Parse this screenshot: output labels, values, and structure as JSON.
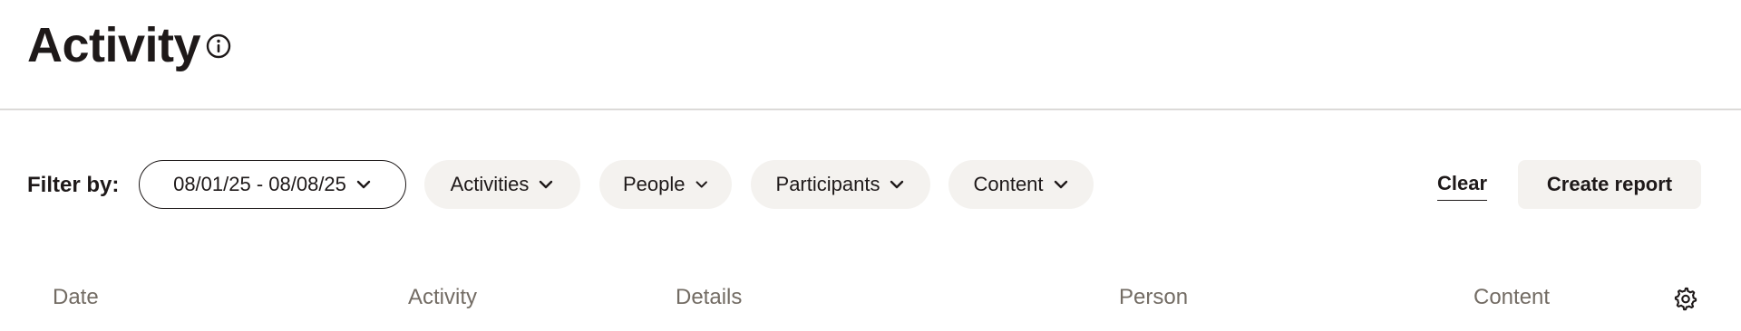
{
  "header": {
    "title": "Activity",
    "info_icon": "info-icon"
  },
  "filters": {
    "label": "Filter by:",
    "date_range": "08/01/25 - 08/08/25",
    "activities": "Activities",
    "people": "People",
    "participants": "Participants",
    "content": "Content",
    "chevron_icon": "chevron-down-icon"
  },
  "actions": {
    "clear": "Clear",
    "create_report": "Create report"
  },
  "table": {
    "columns": [
      "Date",
      "Activity",
      "Details",
      "Person",
      "Content"
    ],
    "settings_icon": "gear-icon"
  },
  "colors": {
    "text": "#1e1919",
    "muted": "#736c64",
    "chip_bg": "#f4f2ef",
    "divider": "#dcdad8"
  }
}
